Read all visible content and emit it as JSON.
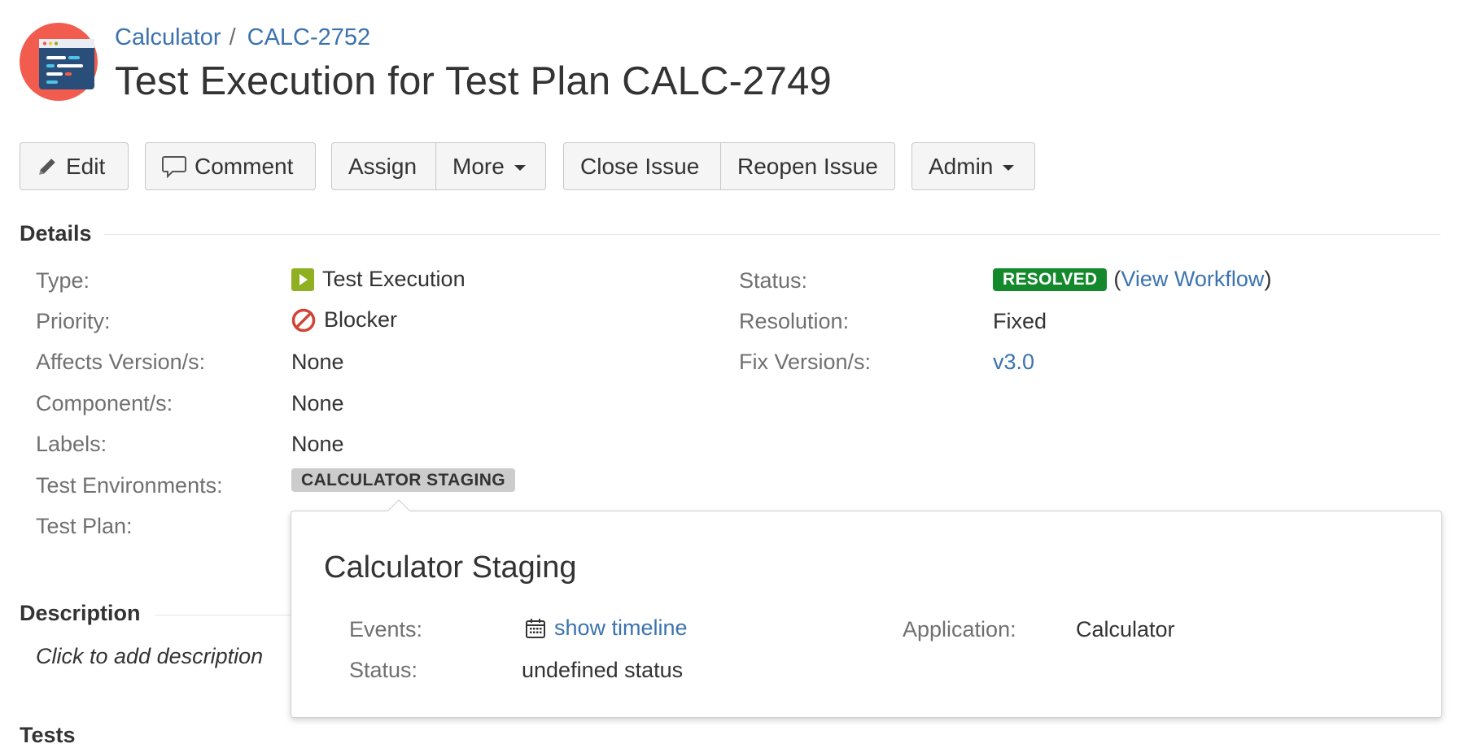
{
  "header": {
    "breadcrumb": {
      "project": "Calculator",
      "separator": "/",
      "issue_key": "CALC-2752"
    },
    "title": "Test Execution for Test Plan CALC-2749"
  },
  "toolbar": {
    "edit": "Edit",
    "comment": "Comment",
    "assign": "Assign",
    "more": "More",
    "close_issue": "Close Issue",
    "reopen_issue": "Reopen Issue",
    "admin": "Admin"
  },
  "details": {
    "heading": "Details",
    "left": [
      {
        "label": "Type:",
        "value": "Test Execution",
        "icon": "test-execution-icon"
      },
      {
        "label": "Priority:",
        "value": "Blocker",
        "icon": "blocker-priority-icon"
      },
      {
        "label": "Affects Version/s:",
        "value": "None"
      },
      {
        "label": "Component/s:",
        "value": "None"
      },
      {
        "label": "Labels:",
        "value": "None"
      },
      {
        "label": "Test Environments:",
        "value": "CALCULATOR STAGING"
      },
      {
        "label": "Test Plan:",
        "value": ""
      }
    ],
    "right": [
      {
        "label": "Status:",
        "value": "RESOLVED",
        "extra_open": "(",
        "extra_link": "View Workflow",
        "extra_close": ")"
      },
      {
        "label": "Resolution:",
        "value": "Fixed"
      },
      {
        "label": "Fix Version/s:",
        "value": "v3.0"
      }
    ]
  },
  "description": {
    "heading": "Description",
    "placeholder": "Click to add description"
  },
  "tests": {
    "heading": "Tests"
  },
  "popup": {
    "title": "Calculator Staging",
    "events_label": "Events:",
    "events_link": "show timeline",
    "status_label": "Status:",
    "status_value": "undefined status",
    "application_label": "Application:",
    "application_value": "Calculator"
  },
  "colors": {
    "link": "#3b73af",
    "resolved": "#14892c",
    "blocker": "#d04437",
    "test_execution": "#8eb021",
    "avatar_bg": "#f15c4f",
    "avatar_doc": "#2a4e7a"
  }
}
